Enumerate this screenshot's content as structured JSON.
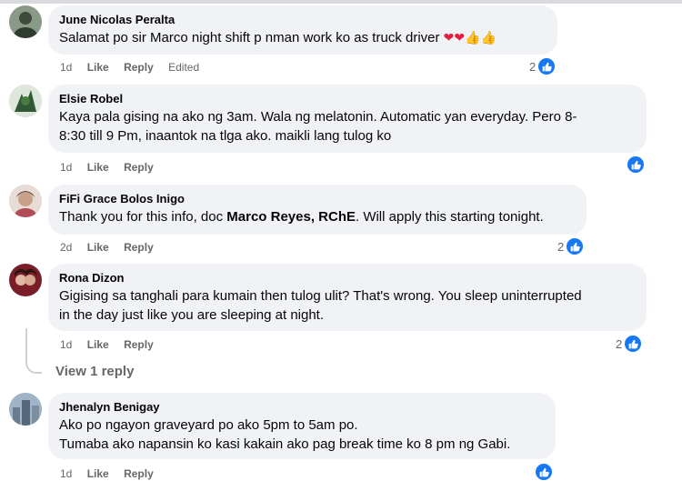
{
  "comments": [
    {
      "author": "June Nicolas Peralta",
      "text": "Salamat po sir Marco night shift p nman work ko as truck driver",
      "emoji_suffix": "❤❤👍👍",
      "time": "1d",
      "like": "Like",
      "reply": "Reply",
      "edited": "Edited",
      "reaction_count": "2"
    },
    {
      "author": "Elsie Robel",
      "lines": [
        "Kaya pala gising na ako ng 3am. Wala ng melatonin. Automatic yan everyday. Pero 8-",
        "8:30 till 9 Pm, inaantok na tlga ako. maikli lang tulog ko"
      ],
      "time": "1d",
      "like": "Like",
      "reply": "Reply"
    },
    {
      "author": "FiFi Grace Bolos Inigo",
      "text_before": "Thank you for this info, doc ",
      "mention": "Marco Reyes, RChE",
      "text_after": ". Will apply this starting tonight.",
      "time": "2d",
      "like": "Like",
      "reply": "Reply",
      "reaction_count": "2"
    },
    {
      "author": "Rona Dizon",
      "lines": [
        "Gigising sa tanghali para kumain then tulog ulit? That's wrong. You sleep uninterrupted",
        "in the day just like you are sleeping at night."
      ],
      "time": "1d",
      "like": "Like",
      "reply": "Reply",
      "reaction_count": "2",
      "view_replies": "View 1 reply"
    },
    {
      "author": "Jhenalyn Benigay",
      "lines": [
        "Ako po ngayon graveyard po ako 5pm to 5am po.",
        "Tumaba ako napansin ko kasi kakain ako pag break time ko 8 pm ng Gabi."
      ],
      "time": "1d",
      "like": "Like",
      "reply": "Reply"
    }
  ],
  "icons": {
    "reaction": "like-thumb-icon",
    "emoji": [
      "red-heart-icon",
      "thumbs-up-icon"
    ]
  },
  "colors": {
    "like_blue": "#1877f2",
    "bubble": "#f0f2f5",
    "meta": "#65676b"
  }
}
